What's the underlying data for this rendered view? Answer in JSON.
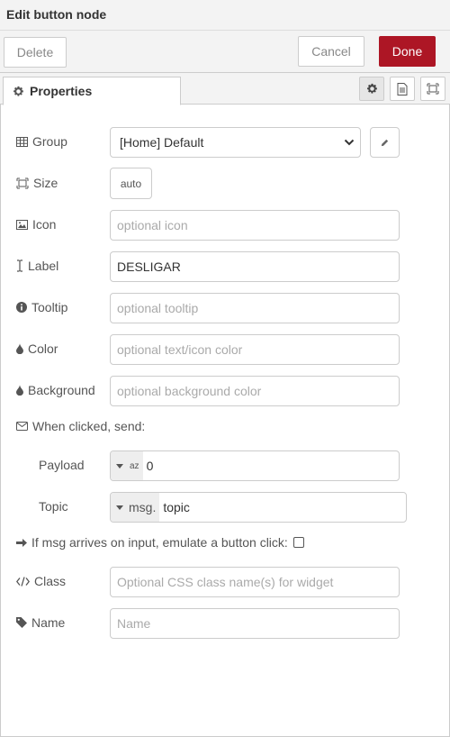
{
  "header": {
    "title": "Edit button node"
  },
  "actions": {
    "delete_label": "Delete",
    "cancel_label": "Cancel",
    "done_label": "Done"
  },
  "tabs": {
    "properties_label": "Properties"
  },
  "form": {
    "group": {
      "label": "Group",
      "value": "[Home] Default"
    },
    "size": {
      "label": "Size",
      "value": "auto"
    },
    "icon": {
      "label": "Icon",
      "placeholder": "optional icon"
    },
    "label": {
      "label": "Label",
      "value": "DESLIGAR"
    },
    "tooltip": {
      "label": "Tooltip",
      "placeholder": "optional tooltip"
    },
    "color": {
      "label": "Color",
      "placeholder": "optional text/icon color"
    },
    "background": {
      "label": "Background",
      "placeholder": "optional background color"
    },
    "when_clicked": {
      "label": "When clicked, send:"
    },
    "payload": {
      "label": "Payload",
      "type_glyph": "az",
      "value": "0"
    },
    "topic": {
      "label": "Topic",
      "type_label": "msg.",
      "value": "topic"
    },
    "emulate": {
      "label": "If msg arrives on input, emulate a button click:",
      "checked": false
    },
    "class": {
      "label": "Class",
      "placeholder": "Optional CSS class name(s) for widget"
    },
    "name": {
      "label": "Name",
      "placeholder": "Name"
    }
  },
  "colors": {
    "accent": "#ad1625",
    "border": "#cccccc",
    "header_bg": "#f3f3f3"
  }
}
